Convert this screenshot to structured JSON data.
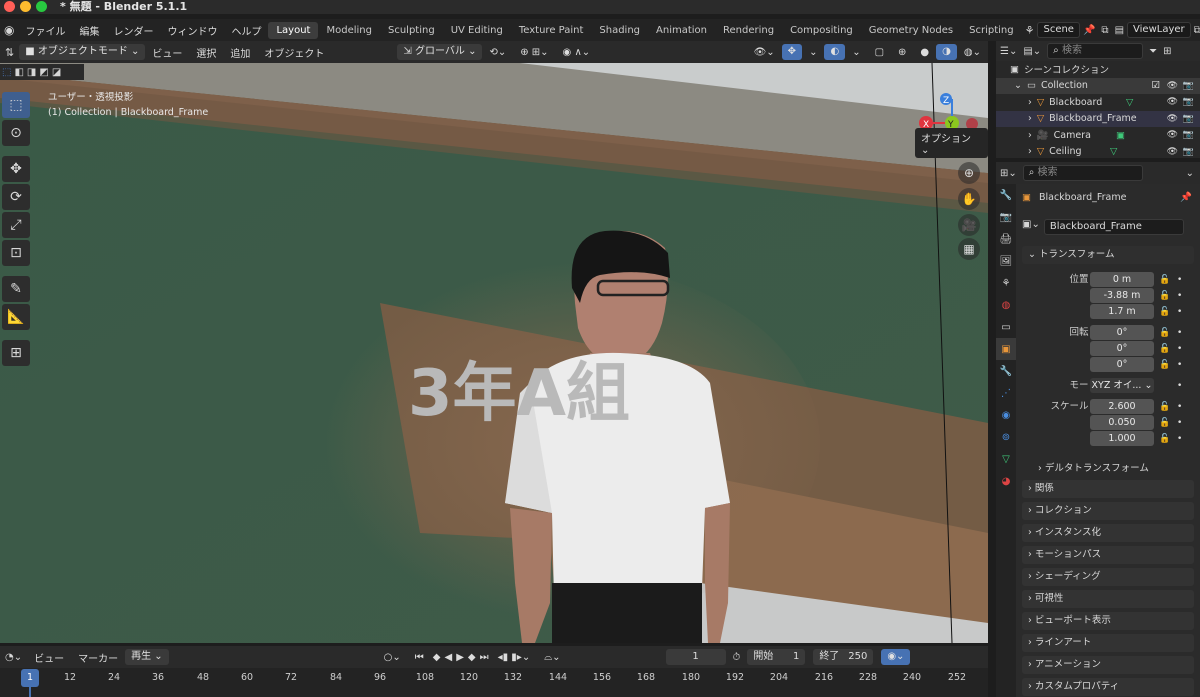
{
  "window": {
    "title": "* 無題 - Blender 5.1.1"
  },
  "menu": [
    "ファイル",
    "編集",
    "レンダー",
    "ウィンドウ",
    "ヘルプ"
  ],
  "workspaces": [
    "Layout",
    "Modeling",
    "Sculpting",
    "UV Editing",
    "Texture Paint",
    "Shading",
    "Animation",
    "Rendering",
    "Compositing",
    "Geometry Nodes",
    "Scripting"
  ],
  "active_workspace": "Layout",
  "scene": "Scene",
  "view_layer": "ViewLayer",
  "viewport_header": {
    "mode": "オブジェクトモード",
    "menus": [
      "ビュー",
      "選択",
      "追加",
      "オブジェクト"
    ],
    "transform_orientation": "グローバル",
    "options": "オプション"
  },
  "viewport_info": {
    "line1": "ユーザー・透視投影",
    "line2": "(1) Collection | Blackboard_Frame"
  },
  "blackboard_text": "3年A組",
  "outliner": {
    "search_placeholder": "検索",
    "root": "シーンコレクション",
    "collection": "Collection",
    "items": [
      "Blackboard",
      "Blackboard_Frame",
      "Camera",
      "Ceiling"
    ]
  },
  "properties": {
    "search_placeholder": "検索",
    "object_name": "Blackboard_Frame",
    "data_name": "Blackboard_Frame",
    "transform_title": "トランスフォーム",
    "location_label": "位置 X",
    "rotation_label": "回転 X",
    "scale_label": "スケール X",
    "mode_label": "モード",
    "mode_value": "XYZ オイ...",
    "location": [
      "0 m",
      "-3.88 m",
      "1.7 m"
    ],
    "rotation": [
      "0°",
      "0°",
      "0°"
    ],
    "scale": [
      "2.600",
      "0.050",
      "1.000"
    ],
    "axis_y": "Y",
    "axis_z": "Z",
    "delta": "デルタトランスフォーム",
    "sections": [
      "関係",
      "コレクション",
      "インスタンス化",
      "モーションパス",
      "シェーディング",
      "可視性",
      "ビューポート表示",
      "ラインアート",
      "アニメーション",
      "カスタムプロパティ"
    ]
  },
  "timeline": {
    "menus": [
      "ビュー",
      "マーカー"
    ],
    "playback": "再生",
    "current_frame": "1",
    "start_label": "開始",
    "start": "1",
    "end_label": "終了",
    "end": "250",
    "ticks": [
      "1",
      "12",
      "24",
      "36",
      "48",
      "60",
      "72",
      "84",
      "96",
      "108",
      "120",
      "132",
      "144",
      "156",
      "168",
      "180",
      "192",
      "204",
      "216",
      "228",
      "240",
      "252"
    ]
  },
  "colors": {
    "accent": "#4772b3",
    "x_axis": "#e0353f",
    "y_axis": "#8bc81f",
    "z_axis": "#3a7fdc"
  }
}
